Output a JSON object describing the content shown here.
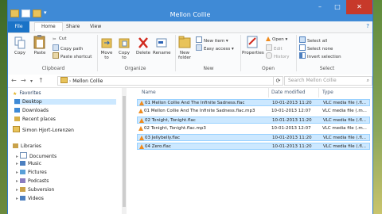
{
  "window": {
    "title": "Mellon Collie"
  },
  "tabs": [
    "File",
    "Home",
    "Share",
    "View"
  ],
  "ribbon": {
    "clipboard": {
      "label": "Clipboard",
      "copy": "Copy",
      "paste": "Paste",
      "cut": "Cut",
      "copy_path": "Copy path",
      "paste_shortcut": "Paste shortcut"
    },
    "organize": {
      "label": "Organize",
      "move_to": "Move to",
      "copy_to": "Copy to",
      "delete": "Delete",
      "rename": "Rename"
    },
    "new": {
      "label": "New",
      "new_folder": "New folder",
      "new_item": "New item",
      "easy_access": "Easy access"
    },
    "open": {
      "label": "Open",
      "properties": "Properties",
      "open": "Open",
      "edit": "Edit",
      "history": "History"
    },
    "select": {
      "label": "Select",
      "select_all": "Select all",
      "select_none": "Select none",
      "invert_selection": "Invert selection"
    }
  },
  "address": {
    "path": "Mellon Collie",
    "search_placeholder": "Search Mellon Collie"
  },
  "nav": {
    "favorites": "Favorites",
    "favorites_items": [
      "Desktop",
      "Downloads",
      "Recent places"
    ],
    "user": "Simon Hjort-Lorenzen",
    "libraries": "Libraries",
    "library_items": [
      "Documents",
      "Music",
      "Pictures",
      "Podcasts",
      "Subversion",
      "Videos"
    ]
  },
  "columns": {
    "name": "Name",
    "date": "Date modified",
    "type": "Type"
  },
  "files": [
    {
      "name": "01 Mellon Collie And The Infinite Sadness.flac",
      "date": "10-01-2013 11:20",
      "type": "VLC media file (.fl..."
    },
    {
      "name": "01 Mellon Collie And The Infinite Sadness.flac.mp3",
      "date": "10-01-2013 12:07",
      "type": "VLC media file (.m..."
    },
    {
      "name": "02 Tonight, Tonight.flac",
      "date": "10-01-2013 11:20",
      "type": "VLC media file (.fl..."
    },
    {
      "name": "02 Tonight, Tonight.flac.mp3",
      "date": "10-01-2013 12:07",
      "type": "VLC media file (.m..."
    },
    {
      "name": "03 Jellybelly.flac",
      "date": "10-01-2013 11:20",
      "type": "VLC media file (.fl..."
    },
    {
      "name": "04 Zero.flac",
      "date": "10-01-2013 11:20",
      "type": "VLC media file (.fl..."
    }
  ],
  "colors": {
    "titlebar": "#3f8ad6",
    "file_tab": "#1a73c7",
    "close": "#c7392a",
    "selection": "#cce8ff",
    "vlc": "#f08b1d"
  }
}
